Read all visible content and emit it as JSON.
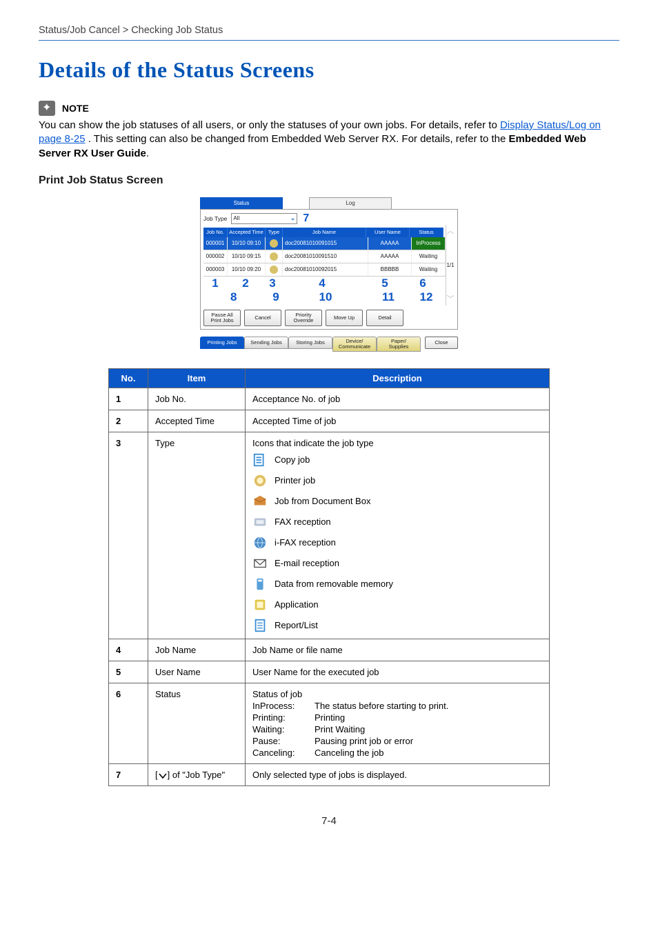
{
  "breadcrumb": "Status/Job Cancel > Checking Job Status",
  "title": "Details of the Status Screens",
  "note": {
    "label": "NOTE",
    "body_before_link": "You can show the job statuses of all users, or only the statuses of your own jobs. For details, refer to ",
    "link_text": "Display Status/Log on page 8-25",
    "body_after_link": ". This setting can also be changed from Embedded Web Server RX. For details, refer to the ",
    "guide_bold": "Embedded Web Server RX User Guide",
    "trail": "."
  },
  "section_heading": "Print Job Status Screen",
  "status_screen": {
    "tab_status": "Status",
    "tab_log": "Log",
    "job_type_label": "Job Type",
    "job_type_value": "All",
    "marker7": "7",
    "headers": {
      "jobno": "Job No.",
      "accepted": "Accepted Time",
      "type": "Type",
      "jobname": "Job Name",
      "username": "User Name",
      "status": "Status"
    },
    "rows": [
      {
        "no": "000001",
        "time": "10/10 09:10",
        "name": "doc20081010091015",
        "user": "AAAAA",
        "status": "InProcess"
      },
      {
        "no": "000002",
        "time": "10/10 09:15",
        "name": "doc20081010091510",
        "user": "AAAAA",
        "status": "Waiting"
      },
      {
        "no": "000003",
        "time": "10/10 09:20",
        "name": "doc20081010092015",
        "user": "BBBBB",
        "status": "Waiting"
      }
    ],
    "pager": "1/1",
    "nums_row1": {
      "n1": "1",
      "n2": "2",
      "n3": "3",
      "n4": "4",
      "n5": "5",
      "n6": "6"
    },
    "nums_row2": {
      "n8": "8",
      "n9": "9",
      "n10": "10",
      "n11": "11",
      "n12": "12"
    },
    "buttons": {
      "pause": "Pause All\nPrint Jobs",
      "cancel": "Cancel",
      "priority": "Priority\nOverride",
      "moveup": "Move Up",
      "detail": "Detail"
    },
    "bottom_tabs": {
      "printing": "Printing Jobs",
      "sending": "Sending Jobs",
      "storing": "Storing Jobs",
      "device": "Device/\nCommunicate",
      "paper": "Paper/\nSupplies",
      "close": "Close"
    }
  },
  "table": {
    "head": {
      "no": "No.",
      "item": "Item",
      "desc": "Description"
    },
    "rows": {
      "r1": {
        "no": "1",
        "item": "Job No.",
        "desc": "Acceptance No. of job"
      },
      "r2": {
        "no": "2",
        "item": "Accepted Time",
        "desc": "Accepted Time of job"
      },
      "r3": {
        "no": "3",
        "item": "Type",
        "desc": "Icons that indicate the job type",
        "types": {
          "copy": "Copy job",
          "printer": "Printer job",
          "docbox": "Job from Document Box",
          "fax": "FAX reception",
          "ifax": "i-FAX reception",
          "email": "E-mail reception",
          "removable": "Data from removable memory",
          "app": "Application",
          "report": "Report/List"
        }
      },
      "r4": {
        "no": "4",
        "item": "Job Name",
        "desc": "Job Name or file name"
      },
      "r5": {
        "no": "5",
        "item": "User Name",
        "desc": "User Name for the executed job"
      },
      "r6": {
        "no": "6",
        "item": "Status",
        "lead": "Status of job",
        "defs": {
          "inprocess_k": "InProcess:",
          "inprocess_v": "The status before starting to print.",
          "printing_k": "Printing:",
          "printing_v": "Printing",
          "waiting_k": "Waiting:",
          "waiting_v": "Print Waiting",
          "pause_k": "Pause:",
          "pause_v": "Pausing print job or error",
          "cancel_k": "Canceling:",
          "cancel_v": "Canceling the job"
        }
      },
      "r7": {
        "no": "7",
        "item_prefix": "[",
        "item_suffix": "] of \"Job Type\"",
        "desc": "Only selected type of jobs is displayed."
      }
    }
  },
  "page_number": "7-4"
}
